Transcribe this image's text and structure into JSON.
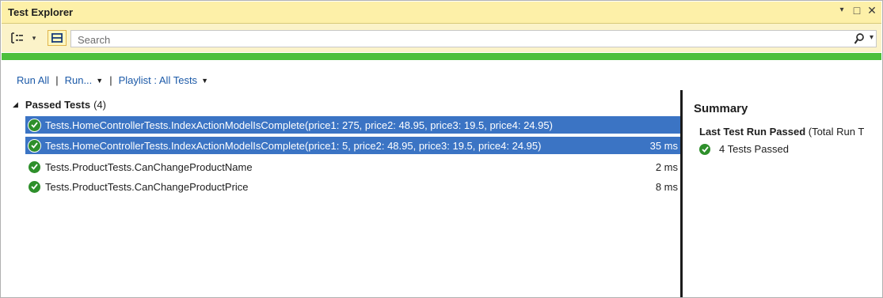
{
  "window": {
    "title": "Test Explorer",
    "controls": [
      "▾",
      "□",
      "✕"
    ]
  },
  "toolbar": {
    "search_placeholder": "Search",
    "buttons": [
      "group-by-icon",
      "group-by-dropdown",
      "list-view-icon"
    ]
  },
  "progress": {
    "state": "passed",
    "fraction": 1.0,
    "color": "#4cc03b"
  },
  "actions": {
    "run_all": "Run All",
    "run": "Run...",
    "playlist": "Playlist : All Tests"
  },
  "group": {
    "label": "Passed Tests",
    "count": "(4)"
  },
  "tests": [
    {
      "name": "Tests.HomeControllerTests.IndexActionModelIsComplete(price1: 275, price2: 48.95, price3: 19.5, price4: 24.95)",
      "duration": "",
      "selected": true
    },
    {
      "name": "Tests.HomeControllerTests.IndexActionModelIsComplete(price1: 5, price2: 48.95, price3: 19.5, price4: 24.95)",
      "duration": "35 ms",
      "selected": true
    },
    {
      "name": "Tests.ProductTests.CanChangeProductName",
      "duration": "2 ms",
      "selected": false
    },
    {
      "name": "Tests.ProductTests.CanChangeProductPrice",
      "duration": "8 ms",
      "selected": false
    }
  ],
  "summary": {
    "title": "Summary",
    "last_run_bold": "Last Test Run Passed",
    "last_run_rest": " (Total Run T",
    "passed": "4 Tests Passed"
  },
  "colors": {
    "accent": "#fdf0a8",
    "selection": "#3b74c4",
    "pass": "#2e8f2b",
    "link": "#1c5aa8"
  }
}
